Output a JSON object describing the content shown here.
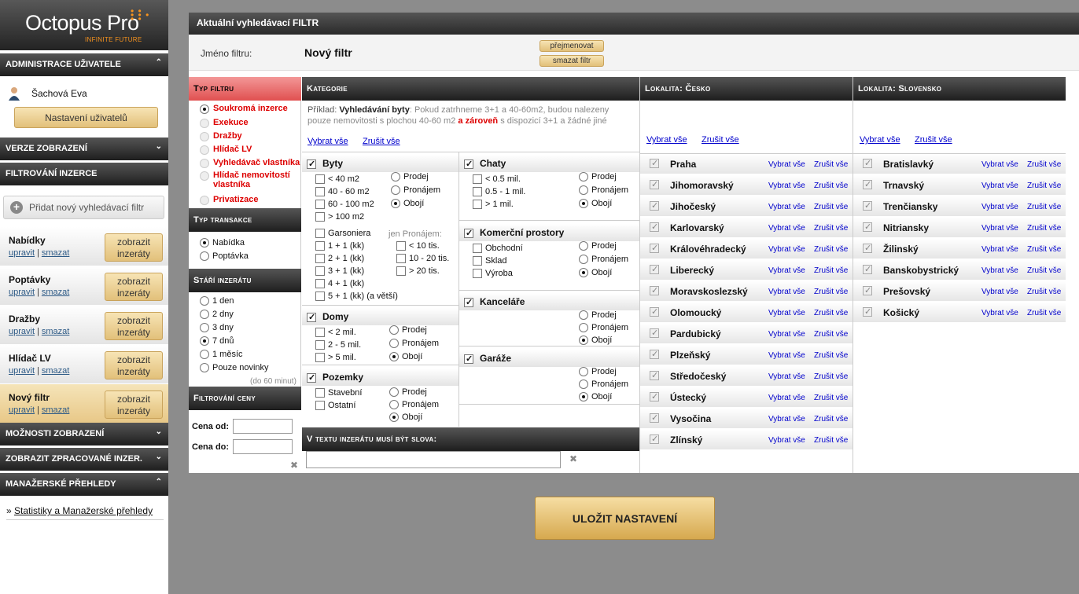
{
  "brand": {
    "name": "Octopus Pro",
    "tagline": "INFINITE FUTURE"
  },
  "sidebar": {
    "admin_title": "ADMINISTRACE UŽIVATELE",
    "user_name": "Šachová Eva",
    "user_settings_button": "Nastavení uživatelů",
    "display_version_title": "VERZE ZOBRAZENÍ",
    "filtering_title": "FILTROVÁNÍ INZERCE",
    "add_filter_button": "Přidat nový vyhledávací filtr",
    "filters": [
      {
        "name": "Nabídky",
        "edit": "upravit",
        "delete": "smazat",
        "show": "zobrazit inzeráty"
      },
      {
        "name": "Poptávky",
        "edit": "upravit",
        "delete": "smazat",
        "show": "zobrazit inzeráty"
      },
      {
        "name": "Dražby",
        "edit": "upravit",
        "delete": "smazat",
        "show": "zobrazit inzeráty"
      },
      {
        "name": "Hlídač LV",
        "edit": "upravit",
        "delete": "smazat",
        "show": "zobrazit inzeráty"
      },
      {
        "name": "Nový filtr",
        "edit": "upravit",
        "delete": "smazat",
        "show": "zobrazit inzeráty"
      }
    ],
    "display_options_title": "MOŽNOSTI ZOBRAZENÍ",
    "processed_title": "ZOBRAZIT ZPRACOVANÉ INZER.",
    "manager_title": "MANAŽERSKÉ PŘEHLEDY",
    "stats_link": "Statistiky a Manažerské přehledy"
  },
  "main": {
    "title": "Aktuální vyhledávací FILTR",
    "filter_name_label": "Jméno filtru:",
    "filter_name": "Nový filtr",
    "rename_button": "přejmenovat",
    "delete_button": "smazat filtr"
  },
  "filter_type": {
    "title": "Typ filtru",
    "options": [
      "Soukromá inzerce",
      "Exekuce",
      "Dražby",
      "Hlídač LV",
      "Vyhledávač vlastníka",
      "Hlídač nemovitostí vlastníka",
      "Privatizace"
    ]
  },
  "transaction": {
    "title": "Typ transakce",
    "options": [
      "Nabídka",
      "Poptávka"
    ]
  },
  "age": {
    "title": "Stáří inzerátu",
    "options": [
      "1 den",
      "2 dny",
      "3 dny",
      "7 dnů",
      "1 měsíc",
      "Pouze novinky"
    ],
    "note": "(do 60 minut)"
  },
  "price": {
    "title": "Filtrování ceny",
    "from_label": "Cena od:",
    "to_label": "Cena do:"
  },
  "categories": {
    "title": "Kategorie",
    "example_label": "Příklad:",
    "example_bold": "Vyhledávání byty",
    "example_text1": ": Pokud zatrhneme 3+1 a 40-60m2, budou nalezeny pouze nemovitosti s plochou 40-60 m2",
    "example_and": "a zároveň",
    "example_text2": "s dispozicí 3+1 a žádné jiné",
    "select_all": "Vybrat vše",
    "cancel_all": "Zrušit vše",
    "byty": {
      "name": "Byty",
      "sizes": [
        "< 40 m2",
        "40 - 60 m2",
        "60 - 100 m2",
        "> 100 m2"
      ],
      "layouts": [
        "Garsoniera",
        "1 + 1 (kk)",
        "2 + 1 (kk)",
        "3 + 1 (kk)",
        "4 + 1 (kk)",
        "5 + 1 (kk) (a větší)"
      ],
      "rent_label": "jen Pronájem:",
      "rent": [
        "< 10 tis.",
        "10 - 20 tis.",
        "> 20 tis."
      ]
    },
    "domy": {
      "name": "Domy",
      "items": [
        "< 2 mil.",
        "2 - 5 mil.",
        "> 5 mil."
      ]
    },
    "pozemky": {
      "name": "Pozemky",
      "items": [
        "Stavební",
        "Ostatní"
      ]
    },
    "chaty": {
      "name": "Chaty",
      "items": [
        "< 0.5 mil.",
        "0.5 - 1 mil.",
        "> 1 mil."
      ]
    },
    "komercni": {
      "name": "Komerční prostory",
      "items": [
        "Obchodní",
        "Sklad",
        "Výroba"
      ]
    },
    "kancelare": {
      "name": "Kanceláře"
    },
    "garaze": {
      "name": "Garáže"
    },
    "trans": [
      "Prodej",
      "Pronájem",
      "Obojí"
    ],
    "text_title": "V textu inzerátu musí být slova:"
  },
  "loc_cz": {
    "title": "Lokalita: Česko",
    "select_all": "Vybrat vše",
    "cancel_all": "Zrušit vše",
    "regions": [
      "Praha",
      "Jihomoravský",
      "Jihočeský",
      "Karlovarský",
      "Královéhradecký",
      "Liberecký",
      "Moravskoslezský",
      "Olomoucký",
      "Pardubický",
      "Plzeňský",
      "Středočeský",
      "Ústecký",
      "Vysočina",
      "Zlínský"
    ]
  },
  "loc_sk": {
    "title": "Lokalita: Slovensko",
    "select_all": "Vybrat vše",
    "cancel_all": "Zrušit vše",
    "regions": [
      "Bratislavký",
      "Trnavský",
      "Trenčiansky",
      "Nitriansky",
      "Žilinský",
      "Banskobystrický",
      "Prešovský",
      "Košický"
    ]
  },
  "save_button": "ULOŽIT NASTAVENÍ"
}
